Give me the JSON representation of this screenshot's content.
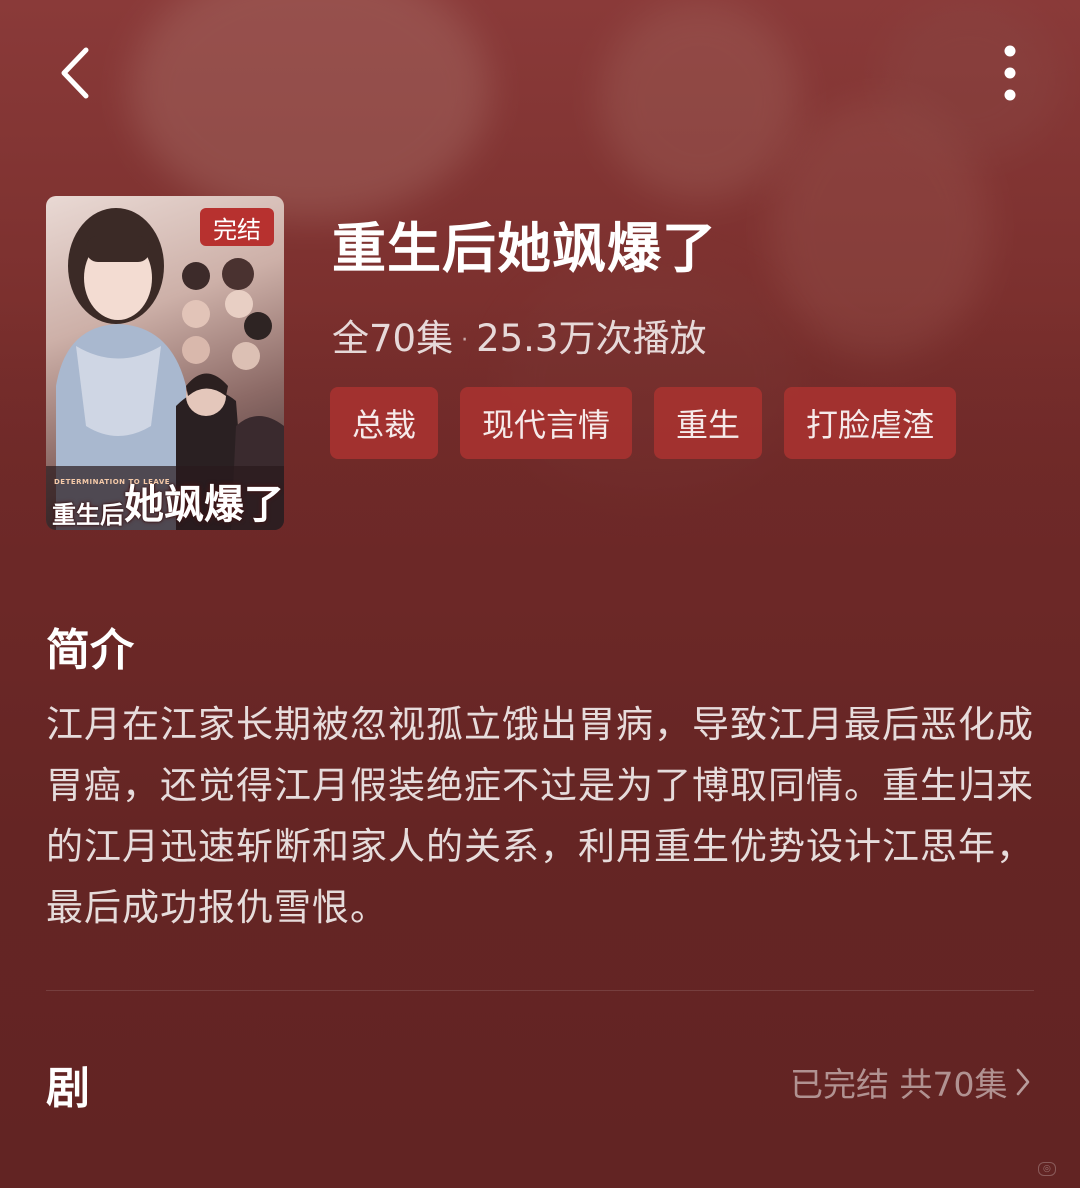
{
  "header": {
    "back_icon": "chevron-left-icon",
    "more_icon": "more-vertical-icon"
  },
  "drama": {
    "poster_badge": "完结",
    "poster_title_small": "重生后",
    "poster_title_big": "她飒爆了",
    "poster_subtitle": "DETERMINATION TO LEAVE",
    "title": "重生后她飒爆了",
    "episodes_total": "全70集",
    "separator": "·",
    "play_count": "25.3万次播放",
    "tags": [
      "总裁",
      "现代言情",
      "重生",
      "打脸虐渣"
    ]
  },
  "synopsis": {
    "heading": "简介",
    "text": "江月在江家长期被忽视孤立饿出胃病，导致江月最后恶化成胃癌，还觉得江月假装绝症不过是为了博取同情。重生归来的江月迅速斩断和家人的关系，利用重生优势设计江思年，最后成功报仇雪恨。"
  },
  "episodes": {
    "heading": "剧",
    "status": "已完结 共70集",
    "chevron_icon": "chevron-right-icon"
  },
  "colors": {
    "background": "#6c2827",
    "tag_bg": "#aa3230",
    "badge_bg": "#b7312f"
  }
}
